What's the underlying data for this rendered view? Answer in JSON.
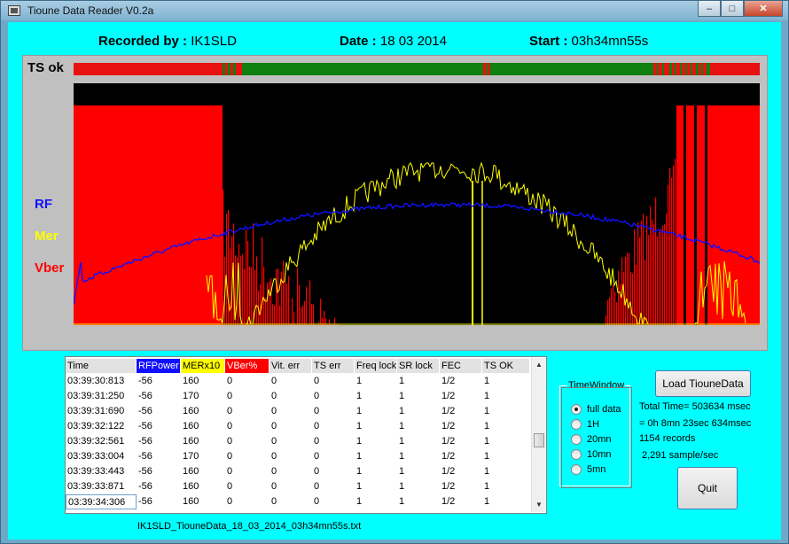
{
  "window": {
    "title": "Tioune Data Reader V0.2a",
    "minimize": "–",
    "maximize": "□",
    "close": "✕"
  },
  "header": {
    "recorded_label": "Recorded by :",
    "recorded_value": "IK1SLD",
    "date_label": "Date :",
    "date_value": "18 03 2014",
    "start_label": "Start :",
    "start_value": "03h34mn55s"
  },
  "graph": {
    "ts_label": "TS ok",
    "rf_label": "RF",
    "mer_label": "Mer",
    "vber_label": "Vber"
  },
  "colors": {
    "background": "#00ffff",
    "rf": "#1010ff",
    "mer": "#ffff00",
    "vber": "#ff0000",
    "ts_ok": "#108010",
    "ts_bad": "#e81010"
  },
  "table": {
    "columns": [
      "Time",
      "RFPower",
      "MERx10",
      "VBer%",
      "Vit. err",
      "TS err",
      "Freq lock",
      "SR lock",
      "FEC",
      "TS OK"
    ],
    "rows": [
      [
        "03:39:30:813",
        "-56",
        "160",
        "0",
        "0",
        "0",
        "1",
        "1",
        "1/2",
        "1"
      ],
      [
        "03:39:31:250",
        "-56",
        "170",
        "0",
        "0",
        "0",
        "1",
        "1",
        "1/2",
        "1"
      ],
      [
        "03:39:31:690",
        "-56",
        "160",
        "0",
        "0",
        "0",
        "1",
        "1",
        "1/2",
        "1"
      ],
      [
        "03:39:32:122",
        "-56",
        "160",
        "0",
        "0",
        "0",
        "1",
        "1",
        "1/2",
        "1"
      ],
      [
        "03:39:32:561",
        "-56",
        "160",
        "0",
        "0",
        "0",
        "1",
        "1",
        "1/2",
        "1"
      ],
      [
        "03:39:33:004",
        "-56",
        "170",
        "0",
        "0",
        "0",
        "1",
        "1",
        "1/2",
        "1"
      ],
      [
        "03:39:33:443",
        "-56",
        "160",
        "0",
        "0",
        "0",
        "1",
        "1",
        "1/2",
        "1"
      ],
      [
        "03:39:33:871",
        "-56",
        "160",
        "0",
        "0",
        "0",
        "1",
        "1",
        "1/2",
        "1"
      ],
      [
        "03:39:34:306",
        "-56",
        "160",
        "0",
        "0",
        "0",
        "1",
        "1",
        "1/2",
        "1"
      ]
    ]
  },
  "filename": "IK1SLD_TiouneData_18_03_2014_03h34mn55s.txt",
  "time_window": {
    "title": "TimeWindow",
    "options": [
      "full data",
      "1H",
      "20mn",
      "10mn",
      "5mn"
    ],
    "selected": "full data"
  },
  "buttons": {
    "load": "Load TiouneData",
    "quit": "Quit"
  },
  "stats": {
    "total_time": "Total Time= 503634 msec",
    "duration": "= 0h 8mn 23sec 634msec",
    "records": "1154 records",
    "rate": "2,291 sample/sec"
  },
  "icons": {
    "scroll_up": "scroll-up-icon",
    "scroll_down": "scroll-down-icon",
    "app": "app-icon"
  }
}
